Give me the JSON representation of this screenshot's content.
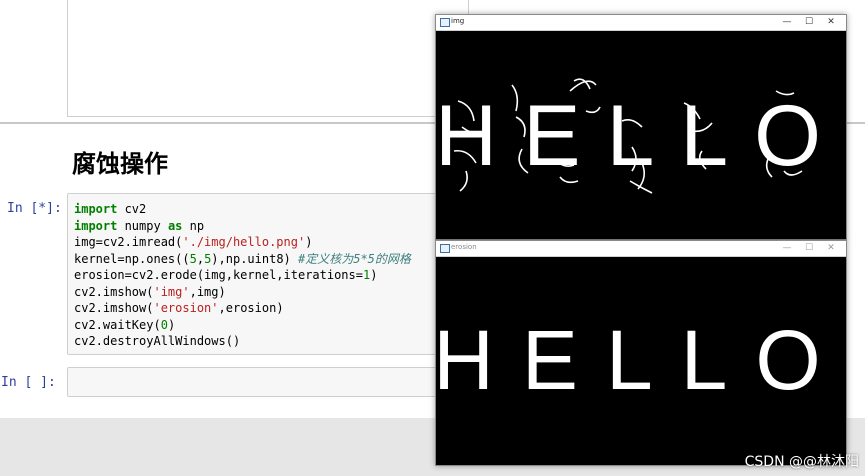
{
  "notebook": {
    "heading": "腐蚀操作",
    "cell1": {
      "prompt": "In  [*]:",
      "lines": [
        [
          {
            "t": "import",
            "c": "kw"
          },
          {
            "t": " cv2",
            "c": ""
          }
        ],
        [
          {
            "t": "import",
            "c": "kw"
          },
          {
            "t": " numpy ",
            "c": ""
          },
          {
            "t": "as",
            "c": "kw"
          },
          {
            "t": " np",
            "c": ""
          }
        ],
        [
          {
            "t": "img=cv2.imread(",
            "c": ""
          },
          {
            "t": "'./img/hello.png'",
            "c": "str"
          },
          {
            "t": ")",
            "c": ""
          }
        ],
        [
          {
            "t": "kernel=np.ones((",
            "c": ""
          },
          {
            "t": "5",
            "c": "num"
          },
          {
            "t": ",",
            "c": ""
          },
          {
            "t": "5",
            "c": "num"
          },
          {
            "t": "),np.uint8) ",
            "c": ""
          },
          {
            "t": "#定义核为5*5的网格",
            "c": "cmt"
          }
        ],
        [
          {
            "t": "erosion=cv2.erode(img,kernel,iterations=",
            "c": ""
          },
          {
            "t": "1",
            "c": "num"
          },
          {
            "t": ")",
            "c": ""
          }
        ],
        [
          {
            "t": "cv2.imshow(",
            "c": ""
          },
          {
            "t": "'img'",
            "c": "str"
          },
          {
            "t": ",img)",
            "c": ""
          }
        ],
        [
          {
            "t": "cv2.imshow(",
            "c": ""
          },
          {
            "t": "'erosion'",
            "c": "str"
          },
          {
            "t": ",erosion)",
            "c": ""
          }
        ],
        [
          {
            "t": "cv2.waitKey(",
            "c": ""
          },
          {
            "t": "0",
            "c": "num"
          },
          {
            "t": ")",
            "c": ""
          }
        ],
        [
          {
            "t": "cv2.destroyAllWindows()",
            "c": ""
          }
        ]
      ]
    },
    "cell2": {
      "prompt": "In  [ ]:"
    }
  },
  "windows": [
    {
      "title": "img",
      "content": "HELLO",
      "hairy": true
    },
    {
      "title": "erosion",
      "content": "HELLO",
      "hairy": false
    }
  ],
  "window_controls": {
    "minimize": "—",
    "maximize": "☐",
    "close": "✕"
  },
  "watermark": "CSDN @@林沐阳",
  "colors": {
    "prompt": "#303f9f",
    "keyword": "#008000",
    "string": "#ba2121",
    "comment": "#408080"
  }
}
